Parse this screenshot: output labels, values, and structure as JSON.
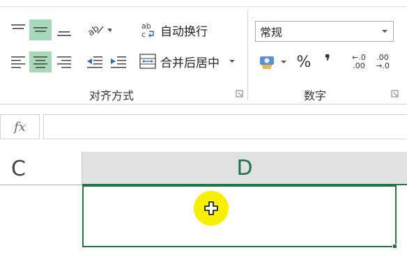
{
  "alignment": {
    "wrap_text_label": "自动换行",
    "merge_center_label": "合并后居中",
    "group_label": "对齐方式"
  },
  "number": {
    "format_value": "常规",
    "percent_symbol": "%",
    "comma_symbol": "❜",
    "increase_decimal_top": "←.0",
    "increase_decimal_bottom": ".00",
    "decrease_decimal_top": ".00",
    "decrease_decimal_bottom": "→.0",
    "group_label": "数字"
  },
  "formula_bar": {
    "fx_label": "fx",
    "value": ""
  },
  "grid": {
    "column_c": "C",
    "column_d": "D"
  },
  "colors": {
    "accent": "#217346",
    "active_button": "#a9d8b8",
    "cursor_highlight": "#f8f000"
  }
}
